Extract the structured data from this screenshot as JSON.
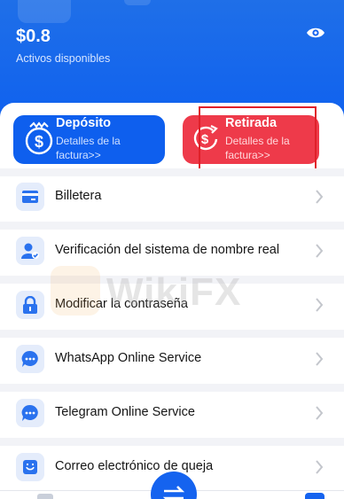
{
  "header": {
    "balance": "$0.8",
    "balance_label": "Activos disponibles",
    "eye_icon": "eye-icon"
  },
  "cards": {
    "deposit": {
      "title": "Depósito",
      "subtitle": "Detalles de la factura>>",
      "icon": "dollar-coin-icon"
    },
    "withdraw": {
      "title": "Retirada",
      "subtitle": "Detalles de la factura>>",
      "icon": "dollar-refresh-icon"
    }
  },
  "menu": [
    {
      "label": "Billetera",
      "icon": "wallet-icon"
    },
    {
      "label": "Verificación del sistema de nombre real",
      "icon": "user-verify-icon"
    },
    {
      "label": "Modificar la contraseña",
      "icon": "lock-icon"
    },
    {
      "label": "WhatsApp Online Service",
      "icon": "chat-icon"
    },
    {
      "label": "Telegram Online Service",
      "icon": "chat-icon"
    },
    {
      "label": "Correo electrónico de queja",
      "icon": "complaint-icon"
    }
  ],
  "watermark": {
    "text": "WikiFX"
  },
  "colors": {
    "brand_blue": "#0e5fee",
    "withdraw_red": "#ee3a4a",
    "highlight_red": "#e0202a"
  }
}
